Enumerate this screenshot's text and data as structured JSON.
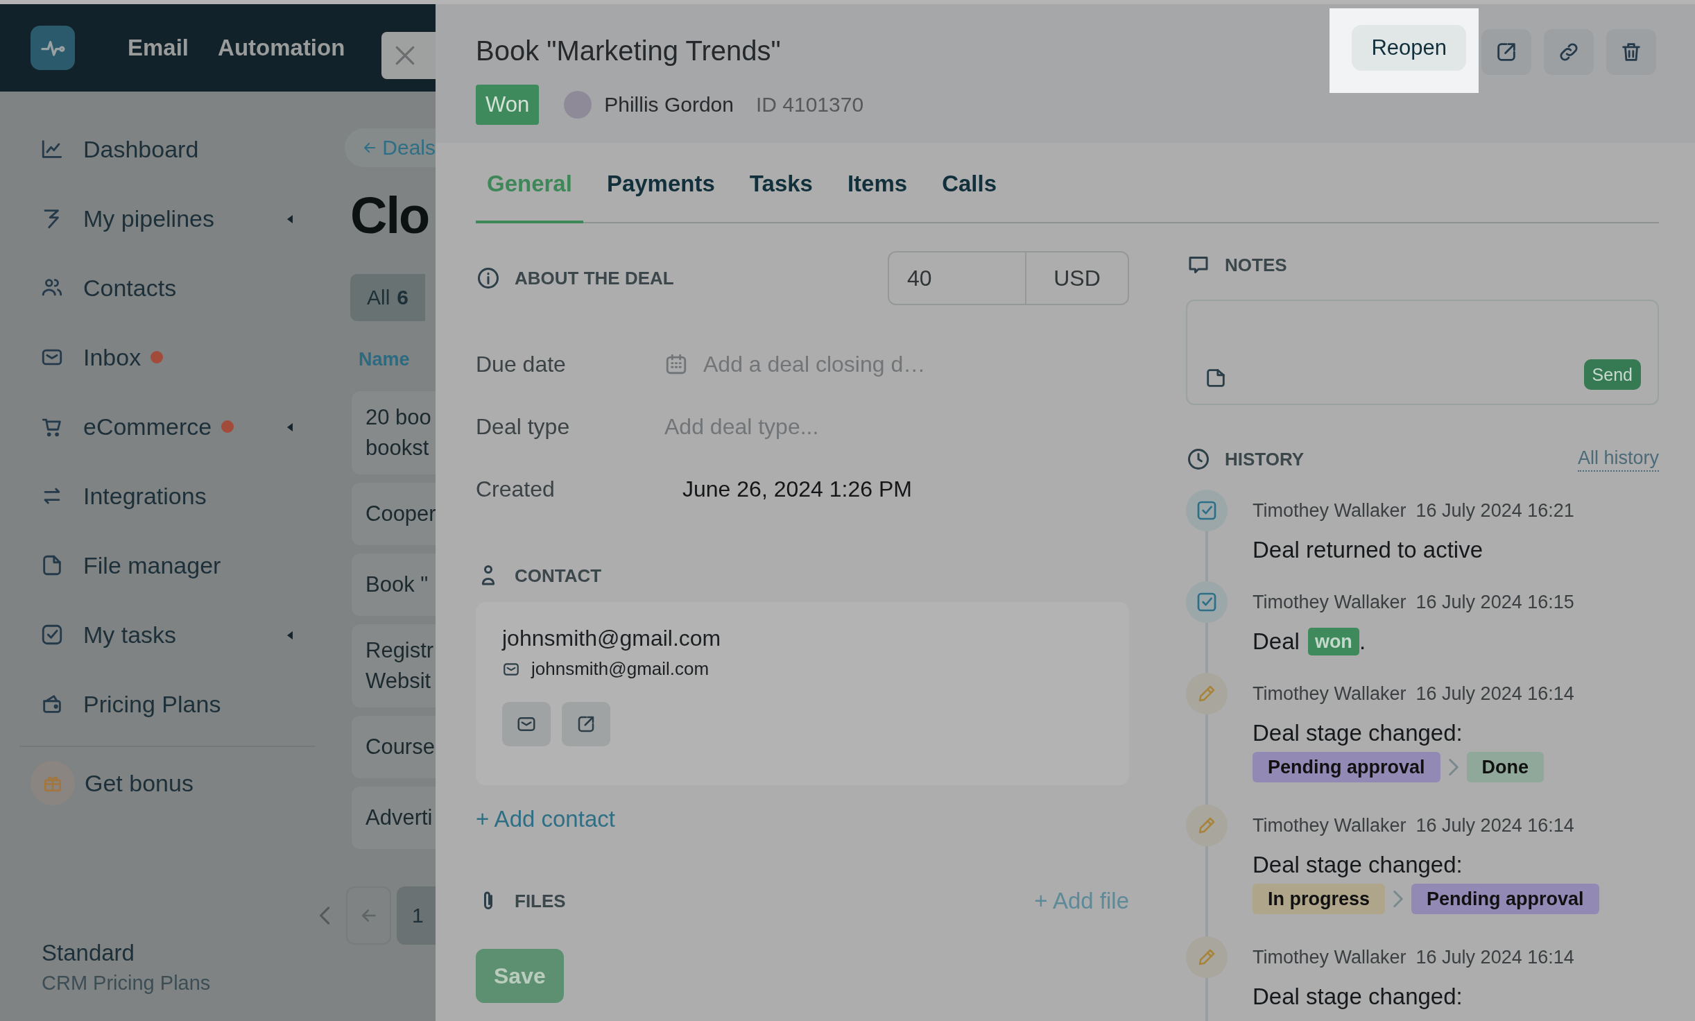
{
  "top_nav": {
    "items": [
      {
        "label": "Email"
      },
      {
        "label": "Automation"
      }
    ]
  },
  "sidebar": {
    "items": [
      {
        "label": "Dashboard",
        "expandable": false,
        "notification": false
      },
      {
        "label": "My pipelines",
        "expandable": true,
        "notification": false
      },
      {
        "label": "Contacts",
        "expandable": false,
        "notification": false
      },
      {
        "label": "Inbox",
        "expandable": false,
        "notification": true
      },
      {
        "label": "eCommerce",
        "expandable": true,
        "notification": true
      },
      {
        "label": "Integrations",
        "expandable": false,
        "notification": false
      },
      {
        "label": "File manager",
        "expandable": false,
        "notification": false
      },
      {
        "label": "My tasks",
        "expandable": true,
        "notification": false
      },
      {
        "label": "Pricing Plans",
        "expandable": false,
        "notification": false
      }
    ],
    "bonus": "Get bonus",
    "plan": {
      "name": "Standard",
      "subtitle": "CRM Pricing Plans"
    }
  },
  "deals_list": {
    "back": "Deals",
    "title": "Clo",
    "tabs": [
      {
        "label": "All",
        "count": "6",
        "selected": true
      }
    ],
    "column": "Name",
    "rows": [
      {
        "lines": [
          "20 boo",
          "bookst"
        ]
      },
      {
        "lines": [
          "Cooper"
        ]
      },
      {
        "lines": [
          "Book \""
        ]
      },
      {
        "lines": [
          "Registr",
          "Websit"
        ]
      },
      {
        "lines": [
          "Course"
        ]
      },
      {
        "lines": [
          "Adverti"
        ]
      }
    ],
    "pagination": {
      "pages": [
        {
          "label": "1",
          "selected": true
        }
      ]
    }
  },
  "deal": {
    "title": "Book \"Marketing Trends\"",
    "status": "Won",
    "owner": "Phillis Gordon",
    "id": "ID 4101370",
    "reopen": "Reopen",
    "tabs": [
      {
        "label": "General",
        "selected": true
      },
      {
        "label": "Payments",
        "selected": false
      },
      {
        "label": "Tasks",
        "selected": false
      },
      {
        "label": "Items",
        "selected": false
      },
      {
        "label": "Calls",
        "selected": false
      }
    ],
    "about": {
      "heading": "ABOUT THE DEAL",
      "amount": "40",
      "currency": "USD",
      "fields": [
        {
          "label": "Due date",
          "kind": "date",
          "placeholder": "Add a deal closing d…"
        },
        {
          "label": "Deal type",
          "kind": "select",
          "placeholder": "Add deal type..."
        },
        {
          "label": "Created",
          "kind": "value",
          "value": "June 26, 2024 1:26 PM"
        }
      ]
    },
    "contact": {
      "heading": "CONTACT",
      "name": "johnsmith@gmail.com",
      "email": "johnsmith@gmail.com",
      "add": "+ Add contact"
    },
    "files": {
      "heading": "FILES",
      "add": "+ Add file"
    },
    "save": "Save",
    "notes": {
      "heading": "NOTES",
      "send": "Send"
    },
    "history": {
      "heading": "HISTORY",
      "all": "All history",
      "entries": [
        {
          "kind": "task",
          "author": "Timothey Wallaker",
          "time": "16 July 2024 16:21",
          "text": "Deal returned to active"
        },
        {
          "kind": "task",
          "author": "Timothey Wallaker",
          "time": "16 July 2024 16:15",
          "text": "Deal",
          "badge": "won",
          "suffix": "."
        },
        {
          "kind": "edit",
          "author": "Timothey Wallaker",
          "time": "16 July 2024 16:14",
          "text": "Deal stage changed:",
          "stages": [
            {
              "label": "Pending approval",
              "color": "#9389b5"
            },
            {
              "label": "Done",
              "color": "#8fa89a"
            }
          ]
        },
        {
          "kind": "edit",
          "author": "Timothey Wallaker",
          "time": "16 July 2024 16:14",
          "text": "Deal stage changed:",
          "stages": [
            {
              "label": "In progress",
              "color": "#aea58a"
            },
            {
              "label": "Pending approval",
              "color": "#9389b5"
            }
          ]
        },
        {
          "kind": "edit",
          "author": "Timothey Wallaker",
          "time": "16 July 2024 16:14",
          "text": "Deal stage changed:"
        }
      ]
    }
  }
}
